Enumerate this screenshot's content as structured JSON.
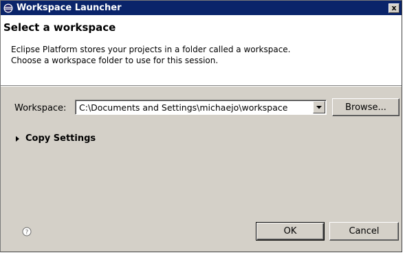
{
  "window": {
    "title": "Workspace Launcher",
    "close_label": "x"
  },
  "banner": {
    "title": "Select a workspace",
    "line1": "Eclipse Platform stores your projects in a folder called a workspace.",
    "line2": "Choose a workspace folder to use for this session."
  },
  "workspace": {
    "label": "Workspace:",
    "value": "C:\\Documents and Settings\\michaejo\\workspace",
    "browse_label": "Browse..."
  },
  "copy_settings": {
    "label": "Copy Settings",
    "expanded": false
  },
  "footer": {
    "ok_label": "OK",
    "cancel_label": "Cancel",
    "help_icon": "help-icon"
  },
  "colors": {
    "titlebar": "#0a246a",
    "dialog_bg": "#d4d0c8",
    "banner_bg": "#ffffff"
  }
}
